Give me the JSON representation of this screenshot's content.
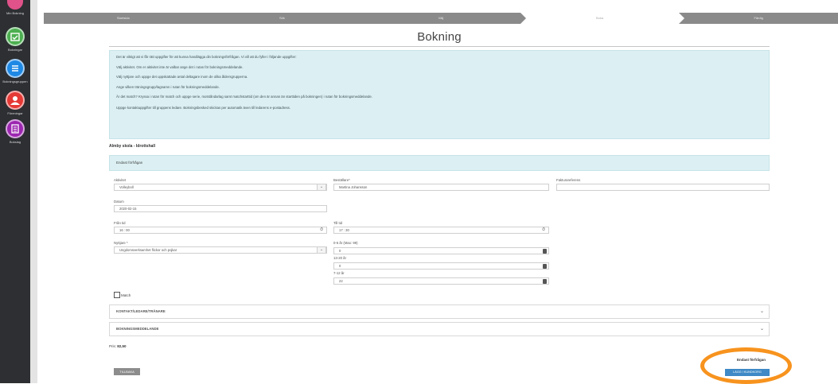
{
  "sidebar": {
    "items": [
      {
        "label": "Min Bokning",
        "icon": "calendar-icon",
        "color": "#e0528a"
      },
      {
        "label": "Bokningar",
        "icon": "calendar-check-icon",
        "color": "#4caf50"
      },
      {
        "label": "Bokningsgruppen",
        "icon": "list-icon",
        "color": "#1e88e5"
      },
      {
        "label": "Föreningar",
        "icon": "users-icon",
        "color": "#e53935"
      },
      {
        "label": "Bokslag",
        "icon": "document-icon",
        "color": "#9c27b0"
      }
    ]
  },
  "steps": [
    {
      "label": "Startsida"
    },
    {
      "label": "Sök"
    },
    {
      "label": "Välj"
    },
    {
      "label": "Boka"
    },
    {
      "label": "Färdig"
    }
  ],
  "page_title": "Bokning",
  "info": {
    "lines": [
      "Det är viktigt att vi får rätt uppgifter för att kunna handlägga din bokningsförfrågan. Vi vill att du fyller i följande uppgifter:",
      "Välj aktivitet. Om er aktivitet inte är valbar ange det i rutan för bokningsmeddelande.",
      "Välj nyttjare och uppge det uppskattade antal deltagare inom de olika åldersgrupperna.",
      "Ange vilken träningsgrupp/lagnamn i rutan för bokningsmeddelande.",
      "Är det match? Kryssa i rutan för match och uppge serie, motståndarlag samt matchstarttid (om den är annan än starttiden på bokningen) i rutan för bokningsmeddelande.",
      "Uppge kontaktuppgifter till gruppens ledare. Bokningsbesked skickas per automatik även till ledarens e-postadress."
    ]
  },
  "venue": "Almby skola - Idrottshall",
  "section_title": "Endast förfrågan",
  "form": {
    "activity_label": "Aktivitet",
    "activity_value": "Volleyboll",
    "orderer_label": "Beställare*",
    "orderer_value": "Martina Johansson",
    "invoice_ref_label": "Fakturareferens",
    "invoice_ref_value": "",
    "date_label": "Datum",
    "date_value": "2020-02-15",
    "from_label": "Från tid",
    "from_value": "16 : 00",
    "to_label": "Till tid",
    "to_value": "17 : 30",
    "user_label": "Nyttjare *",
    "user_value": "Ungdomsverksamhet flickor och pojkar",
    "age1_label": "0-6 år (Max: 99)",
    "age1_value": "0",
    "age2_label": "13-20 år",
    "age2_value": "0",
    "age3_label": "7-12 år",
    "age3_value": "22",
    "match_label": "Match"
  },
  "accordions": {
    "contact": "KONTAKT/LEDARE/TRÄNARE",
    "message": "BOKNINGSMEDDELANDE"
  },
  "price": {
    "label": "Pris:",
    "value": "82,50"
  },
  "buttons": {
    "back": "TILLBAKA",
    "only_request": "Endast förfrågan",
    "add_to_cart": "LÄGG I KUNDKORG"
  },
  "colors": {
    "accent": "#3e89c6",
    "info_bg": "#dcf0f3",
    "highlight": "#f7931e",
    "sidebar": "#2d2f33"
  }
}
